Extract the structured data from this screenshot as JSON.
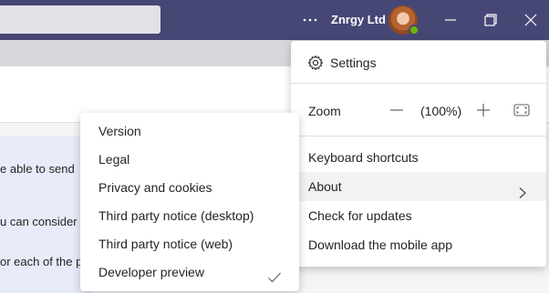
{
  "titlebar": {
    "org_name": "Znrgy Ltd",
    "more_icon": "more-horizontal-icon",
    "colors": {
      "background": "#464775",
      "presence": "#6bb700"
    }
  },
  "background": {
    "text_lines": [
      "e able to send",
      "u can consider",
      "or each of the p"
    ]
  },
  "menu": {
    "settings_label": "Settings",
    "zoom_label": "Zoom",
    "zoom_value": "(100%)",
    "items": [
      {
        "label": "Keyboard shortcuts"
      },
      {
        "label": "About",
        "has_submenu": true,
        "highlighted": true
      },
      {
        "label": "Check for updates"
      },
      {
        "label": "Download the mobile app"
      }
    ]
  },
  "about_menu": {
    "items": [
      {
        "label": "Version"
      },
      {
        "label": "Legal"
      },
      {
        "label": "Privacy and cookies"
      },
      {
        "label": "Third party notice (desktop)"
      },
      {
        "label": "Third party notice (web)"
      },
      {
        "label": "Developer preview",
        "checked": true
      }
    ]
  }
}
